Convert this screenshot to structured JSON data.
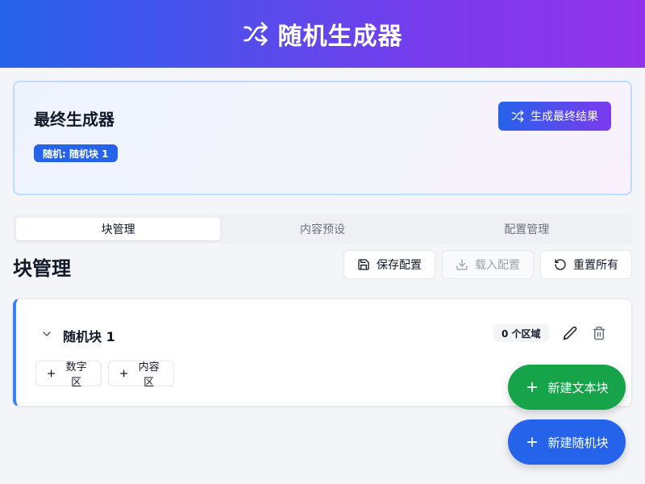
{
  "header": {
    "title": "随机生成器",
    "icon": "shuffle-icon"
  },
  "final_generator": {
    "title": "最终生成器",
    "badge": "随机: 随机块 1",
    "generate_label": "生成最终结果"
  },
  "tabs": [
    {
      "label": "块管理",
      "active": true
    },
    {
      "label": "内容预设",
      "active": false
    },
    {
      "label": "配置管理",
      "active": false
    }
  ],
  "section": {
    "title": "块管理",
    "save_label": "保存配置",
    "load_label": "载入配置",
    "reset_label": "重置所有"
  },
  "block": {
    "title": "随机块 1",
    "region_count": "0 个区域",
    "add_number_label": "数字区",
    "add_content_label": "内容区"
  },
  "fab": {
    "new_text_label": "新建文本块",
    "new_random_label": "新建随机块"
  },
  "colors": {
    "primary": "#2563eb",
    "accent": "#7c3aed",
    "success": "#16a34a"
  }
}
